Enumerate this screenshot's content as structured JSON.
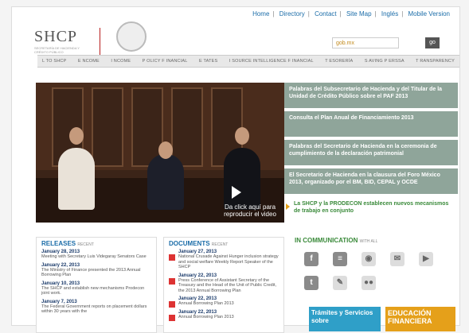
{
  "header": {
    "links": [
      "Home",
      "Directory",
      "Contact",
      "Site Map",
      "Inglés",
      "Mobile Version"
    ],
    "logo_text": "SHCP",
    "logo_sub": "SECRETARÍA DE HACIENDA Y CRÉDITO PÚBLICO",
    "search_value": "gob.mx",
    "go_label": "go"
  },
  "nav": {
    "items": [
      "L TO SHCP",
      "E NCOME",
      "I NCOME",
      "P OLICY F INANCIAL",
      "E TATES",
      "I SOURCE INTELLIGENCE F INANCIAL",
      "T ESORERÍA",
      "S AVING P ERSSA",
      "T RANSPARENCY"
    ]
  },
  "hero": {
    "play_text": "Da click aquí para reproducir el video"
  },
  "news": [
    {
      "text": "Palabras del Subsecretario de Hacienda y del Titular de la Unidad de Crédito Público sobre el PAF 2013",
      "style": "dark"
    },
    {
      "text": "Consulta el Plan Anual de Financiamiento 2013",
      "style": "dark"
    },
    {
      "text": "Palabras del Secretario de Hacienda en la ceremonia de cumplimiento de la declaración patrimonial",
      "style": "dark"
    },
    {
      "text": "El Secretario de Hacienda en la clausura del Foro México 2013, organizado por el BM, BID, CEPAL y OCDE",
      "style": "dark"
    },
    {
      "text": "La SHCP y la PRODECON establecen nuevos mecanismos de trabajo en conjunto",
      "style": "light"
    }
  ],
  "releases": {
    "title": "RELEASES",
    "tag": "RECENT",
    "items": [
      {
        "date": "January 28, 2013",
        "text": "Meeting with Secretary Luis Videgaray Senators Case"
      },
      {
        "date": "January 22, 2013",
        "text": "The Ministry of Finance presented the 2013 Annual Borrowing Plan"
      },
      {
        "date": "January 10, 2013",
        "text": "The SHCP and establish new mechanisms Prodecon joint work."
      },
      {
        "date": "January 7, 2013",
        "text": "The Federal Government reports on placement dollars within 30 years with the"
      }
    ]
  },
  "documents": {
    "title": "DOCUMENTS",
    "tag": "RECENT",
    "items": [
      {
        "date": "January 27, 2013",
        "text": "National Crusade Against Hunger inclusion strategy and social welfare Weekly Report Speaker of the SHCP"
      },
      {
        "date": "January 22, 2013",
        "text": "Press Conference of Assistant Secretary of the Treasury and the Head of the Unit of Public Credit, the 2013 Annual Borrowing Plan"
      },
      {
        "date": "January 22, 2013",
        "text": "Annual Borrowing Plan 2013"
      },
      {
        "date": "January 22, 2013",
        "text": "Annual Borrowing Plan 2013"
      }
    ]
  },
  "communication": {
    "title": "IN COMMUNICATION",
    "tag": "WITH ALL",
    "icons": [
      {
        "name": "facebook-icon",
        "glyph": "f",
        "light": false
      },
      {
        "name": "flickr-icon",
        "glyph": "≡",
        "light": false
      },
      {
        "name": "podcast-icon",
        "glyph": "◉",
        "light": true
      },
      {
        "name": "rss-icon",
        "glyph": "✉",
        "light": true
      },
      {
        "name": "youtube-icon",
        "glyph": "▶",
        "light": true
      },
      {
        "name": "twitter-icon",
        "glyph": "t",
        "light": false
      },
      {
        "name": "wire-icon",
        "glyph": "✎",
        "light": true
      },
      {
        "name": "flickr2-icon",
        "glyph": "●●",
        "light": true
      }
    ],
    "banner1": "Trámites y Servicios sobre",
    "banner2": "EDUCACIÓN FINANCIERA"
  }
}
